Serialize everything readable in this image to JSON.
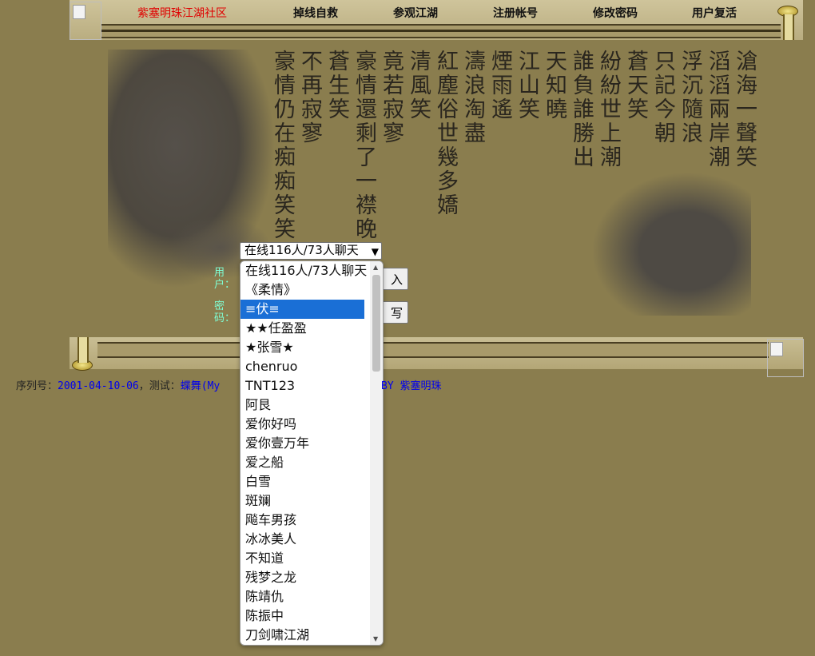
{
  "nav": {
    "home": "紫塞明珠江湖社区",
    "items": [
      "掉线自救",
      "参观江湖",
      "注册帐号",
      "修改密码",
      "用户复活"
    ]
  },
  "poem": {
    "columns": [
      "滄海一聲笑",
      "滔滔兩岸潮",
      "浮沉隨浪",
      "只記今朝",
      "蒼天笑",
      "紛紛世上潮",
      "誰負誰勝出",
      "天知曉",
      "江山笑",
      "煙雨遙",
      "濤浪淘盡",
      "紅塵俗世幾多嬌",
      "清風笑",
      "竟若寂寥",
      "豪情還剩了一襟晚",
      "蒼生笑",
      "不再寂寥",
      "豪情仍在痴痴笑笑"
    ]
  },
  "form": {
    "user_label": "用户：",
    "pass_label": "密码：",
    "enter_button": "入",
    "write_button": "写"
  },
  "room_select": {
    "selected": "在线116人/73人聊天",
    "options": [
      "在线116人/73人聊天",
      "《柔情》",
      "≡伏≡",
      "★★任盈盈",
      "★张雪★",
      "chenruo",
      "TNT123",
      "阿艮",
      "爱你好吗",
      "爱你壹万年",
      "爱之船",
      "白雪",
      "斑斓",
      "飚车男孩",
      "冰冰美人",
      "不知道",
      "残梦之龙",
      "陈靖仇",
      "陈振中",
      "刀剑啸江湖"
    ],
    "highlighted_index": 2
  },
  "footer": {
    "serial_label": "序列号：",
    "serial_value": "2001-04-10-06",
    "test_label": "，测试：",
    "test_value": "蝶舞(My",
    "by_text": "BY 紫塞明珠"
  },
  "colors": {
    "background": "#8a7d4e",
    "label": "#7fffd4",
    "home_link": "#e00000",
    "selection": "#1a6fd6"
  }
}
